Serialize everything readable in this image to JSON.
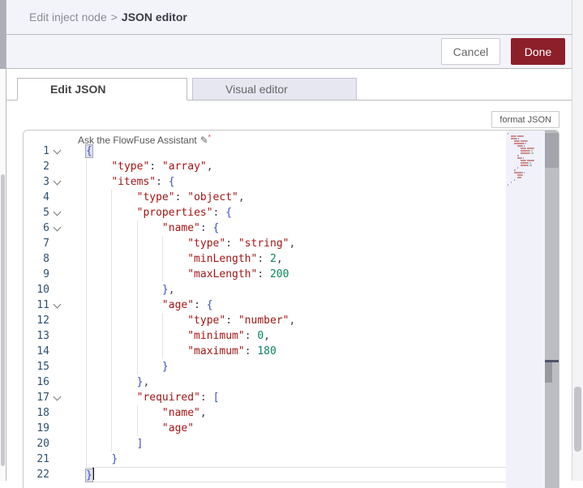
{
  "breadcrumb": {
    "parent": "Edit inject node",
    "separator": ">",
    "current": "JSON editor"
  },
  "actions": {
    "cancel": "Cancel",
    "done": "Done",
    "done_color": "#8C1F2A"
  },
  "tabs": [
    {
      "label": "Edit JSON",
      "active": true
    },
    {
      "label": "Visual editor",
      "active": false
    }
  ],
  "format_button_label": "format JSON",
  "editor": {
    "assistant_placeholder": "Ask the FlowFuse Assistant",
    "language": "json",
    "cursor_line": 22,
    "folded_lines": [
      1,
      3,
      5,
      6,
      11,
      17
    ],
    "lines": [
      "{",
      "    \"type\": \"array\",",
      "    \"items\": {",
      "        \"type\": \"object\",",
      "        \"properties\": {",
      "            \"name\": {",
      "                \"type\": \"string\",",
      "                \"minLength\": 2,",
      "                \"maxLength\": 200",
      "            },",
      "            \"age\": {",
      "                \"type\": \"number\",",
      "                \"minimum\": 0,",
      "                \"maximum\": 180",
      "            }",
      "        },",
      "        \"required\": [",
      "            \"name\",",
      "            \"age\"",
      "        ]",
      "    }",
      "}"
    ],
    "colors": {
      "string": "#a31515",
      "number": "#098658",
      "bracket": "#4050c8",
      "punctuation": "#424242",
      "default": "#333333",
      "line_number": "#2e5170"
    }
  }
}
